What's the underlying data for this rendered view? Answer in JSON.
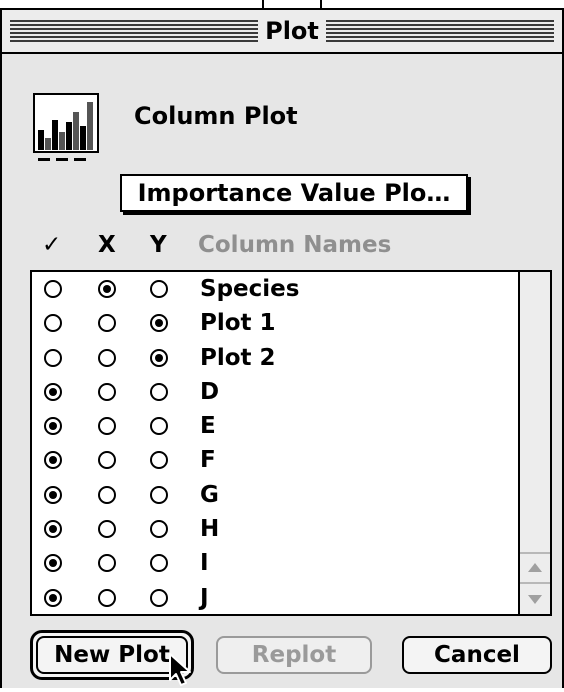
{
  "window": {
    "title": "Plot"
  },
  "header": {
    "plot_type_label": "Column Plot",
    "icon": "column-plot-icon"
  },
  "popup": {
    "selected": "Importance Value Plo…"
  },
  "columns_header": {
    "check": "✓",
    "x": "X",
    "y": "Y",
    "names": "Column Names"
  },
  "rows": [
    {
      "name": "Species",
      "check": false,
      "x": true,
      "y": false
    },
    {
      "name": "Plot 1",
      "check": false,
      "x": false,
      "y": true
    },
    {
      "name": "Plot 2",
      "check": false,
      "x": false,
      "y": true
    },
    {
      "name": "D",
      "check": true,
      "x": false,
      "y": false
    },
    {
      "name": "E",
      "check": true,
      "x": false,
      "y": false
    },
    {
      "name": "F",
      "check": true,
      "x": false,
      "y": false
    },
    {
      "name": "G",
      "check": true,
      "x": false,
      "y": false
    },
    {
      "name": "H",
      "check": true,
      "x": false,
      "y": false
    },
    {
      "name": "I",
      "check": true,
      "x": false,
      "y": false
    },
    {
      "name": "J",
      "check": true,
      "x": false,
      "y": false
    }
  ],
  "buttons": {
    "new_plot": "New Plot",
    "replot": "Replot",
    "cancel": "Cancel"
  },
  "colors": {
    "window_bg": "#e6e6e6",
    "disabled_text": "#9a9a9a",
    "column_names_header": "#8f8f8f"
  }
}
